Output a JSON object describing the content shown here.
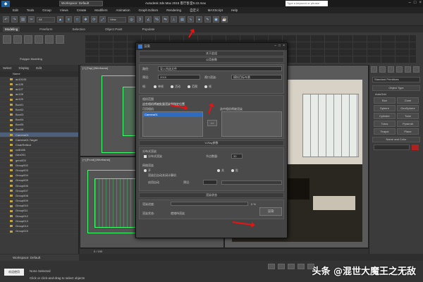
{
  "titlebar": {
    "workspace": "Workspace: Default",
    "title": "Autodesk 3ds Max 2015    客厅卧室9.22.max",
    "search": "Type a keyword or phrase"
  },
  "menu": [
    "Edit",
    "Tools",
    "Group",
    "Views",
    "Create",
    "Modifiers",
    "Animation",
    "Graph Editors",
    "Rendering",
    "自定义",
    "MAXScript",
    "Help"
  ],
  "toolbar": {
    "filter": "All",
    "view": "View"
  },
  "ribbon": {
    "tabs": [
      "Modeling",
      "Freeform",
      "Selection",
      "Object Paint",
      "Populate"
    ],
    "panel_label": "Polygon Modeling"
  },
  "explorer": {
    "tabs": [
      "Select",
      "Display",
      "Edit"
    ],
    "column": "Name",
    "items": [
      "ac10105",
      "ac126",
      "ac127",
      "ac128",
      "ac129",
      "Box01",
      "Box02",
      "Box03",
      "Box04",
      "Box05",
      "Box06",
      "Camera01",
      "Camera01.Target",
      "ChairReflect",
      "ccl6186",
      "Geo001",
      "gero003",
      "Group002",
      "Group003",
      "Group004",
      "Group005",
      "Group006",
      "Group007",
      "Group008",
      "Group009",
      "Group010",
      "Group011",
      "Group012",
      "Group013",
      "Group014",
      "Group015"
    ],
    "selected_index": 11
  },
  "viewports": {
    "top": "[+] [Top] [Wireframe]",
    "front": "[+] [Front] [Wireframe]",
    "persp": ""
  },
  "cmdpanel": {
    "dropdown": "Standard Primitives",
    "section_type": "Object Type",
    "autogrid": "AutoGrid",
    "buttons": [
      "Box",
      "Cone",
      "Sphere",
      "GeoSphere",
      "Cylinder",
      "Tube",
      "Torus",
      "Pyramid",
      "Teapot",
      "Plane"
    ],
    "section_name": "Name and Color"
  },
  "timeline": {
    "label": "0 / 100"
  },
  "wsbar": {
    "label": "Workspace: Default"
  },
  "status": {
    "line1": "None Selected",
    "line2": "Click or click-and-drag to select objects",
    "logo": "欢迎使用",
    "addtime": "Add Time Tag"
  },
  "watermark": "头条 @混世大魔王之无敌",
  "dialog": {
    "title": "渲染",
    "section_about": "关于此组",
    "section_common": "公用参数",
    "path_label": "路径:",
    "path_value": "导入所选文件",
    "preset_label": "预设:",
    "preset_value": "2015",
    "viewport_label": "视口渲染:",
    "viewport_value": "模拟目标布景",
    "range_label": "帧:",
    "range_opts": [
      "单帧",
      "活动",
      "范围",
      "帧"
    ],
    "camera_section": "相机范围",
    "camera_hint": "这些相机将被批量渲染到指定位置",
    "camera_list_label": "可用相机",
    "camera_item": "Camera01",
    "right_list_label": "选中相机将被渲染",
    "move_button": ">>",
    "section_irender": "V-Ray参数",
    "dist_render": "分布式渲染",
    "dist_opt": "分布式渲染",
    "node_label": "节点数量:",
    "node_value": "30",
    "net_section": "网络渲染",
    "net_opts": [
      "开",
      "关",
      "批"
    ],
    "net_check": "渲染后自动关闭计算机",
    "net_check2": "启用自动",
    "net_label": "预设:",
    "status_section": "渲染状态",
    "progress_label": "渲染进度:",
    "progress_pct": "0 %",
    "progress": 0,
    "status_label": "渲染状态:",
    "status_value": "就绪待渲染",
    "render_button": "渲染"
  },
  "colors": {
    "accent": "#2f6bbf",
    "wire_green": "#3dff6a",
    "arrow": "#ee1111",
    "swatch": "#b02020"
  }
}
